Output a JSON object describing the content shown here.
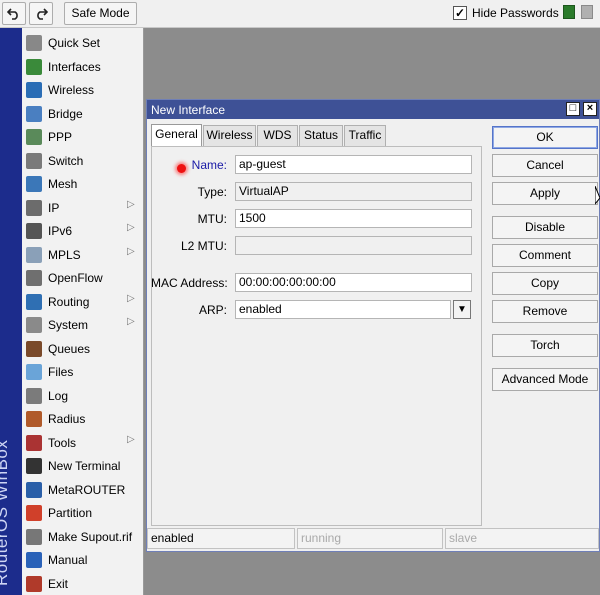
{
  "toolbar": {
    "undo_icon": "undo-icon",
    "redo_icon": "redo-icon",
    "safe_mode_label": "Safe Mode",
    "hide_passwords_checked": true,
    "hide_passwords_check": "✓",
    "hide_passwords_label": "Hide Passwords"
  },
  "brand": "RouterOS WinBox",
  "menu": {
    "items": [
      {
        "label": "Quick Set",
        "icon": "quick-set-icon",
        "submenu": false
      },
      {
        "label": "Interfaces",
        "icon": "interfaces-icon",
        "submenu": false
      },
      {
        "label": "Wireless",
        "icon": "wireless-icon",
        "submenu": false
      },
      {
        "label": "Bridge",
        "icon": "bridge-icon",
        "submenu": false
      },
      {
        "label": "PPP",
        "icon": "ppp-icon",
        "submenu": false
      },
      {
        "label": "Switch",
        "icon": "switch-icon",
        "submenu": false
      },
      {
        "label": "Mesh",
        "icon": "mesh-icon",
        "submenu": false
      },
      {
        "label": "IP",
        "icon": "ip-icon",
        "submenu": true
      },
      {
        "label": "IPv6",
        "icon": "ipv6-icon",
        "submenu": true
      },
      {
        "label": "MPLS",
        "icon": "mpls-icon",
        "submenu": true
      },
      {
        "label": "OpenFlow",
        "icon": "openflow-icon",
        "submenu": false
      },
      {
        "label": "Routing",
        "icon": "routing-icon",
        "submenu": true
      },
      {
        "label": "System",
        "icon": "system-icon",
        "submenu": true
      },
      {
        "label": "Queues",
        "icon": "queues-icon",
        "submenu": false
      },
      {
        "label": "Files",
        "icon": "files-icon",
        "submenu": false
      },
      {
        "label": "Log",
        "icon": "log-icon",
        "submenu": false
      },
      {
        "label": "Radius",
        "icon": "radius-icon",
        "submenu": false
      },
      {
        "label": "Tools",
        "icon": "tools-icon",
        "submenu": true
      },
      {
        "label": "New Terminal",
        "icon": "terminal-icon",
        "submenu": false
      },
      {
        "label": "MetaROUTER",
        "icon": "metarouter-icon",
        "submenu": false
      },
      {
        "label": "Partition",
        "icon": "partition-icon",
        "submenu": false
      },
      {
        "label": "Make Supout.rif",
        "icon": "supout-icon",
        "submenu": false
      },
      {
        "label": "Manual",
        "icon": "manual-icon",
        "submenu": false
      },
      {
        "label": "Exit",
        "icon": "exit-icon",
        "submenu": false
      }
    ]
  },
  "dialog": {
    "title": "New Interface",
    "tabs": [
      "General",
      "Wireless",
      "WDS",
      "Status",
      "Traffic"
    ],
    "active_tab": "General",
    "fields": {
      "name_label": "Name:",
      "name_value": "ap-guest",
      "type_label": "Type:",
      "type_value": "VirtualAP",
      "mtu_label": "MTU:",
      "mtu_value": "1500",
      "l2mtu_label": "L2 MTU:",
      "l2mtu_value": "",
      "mac_label": "MAC Address:",
      "mac_value": "00:00:00:00:00:00",
      "arp_label": "ARP:",
      "arp_value": "enabled"
    },
    "buttons": {
      "ok": "OK",
      "cancel": "Cancel",
      "apply": "Apply",
      "disable": "Disable",
      "comment": "Comment",
      "copy": "Copy",
      "remove": "Remove",
      "torch": "Torch",
      "advanced": "Advanced Mode"
    },
    "status": [
      "enabled",
      "running",
      "slave"
    ]
  },
  "colors": {
    "title_bar": "#3e5196",
    "brand_bar": "#1c2c8c",
    "required_marker": "#ee1111"
  }
}
